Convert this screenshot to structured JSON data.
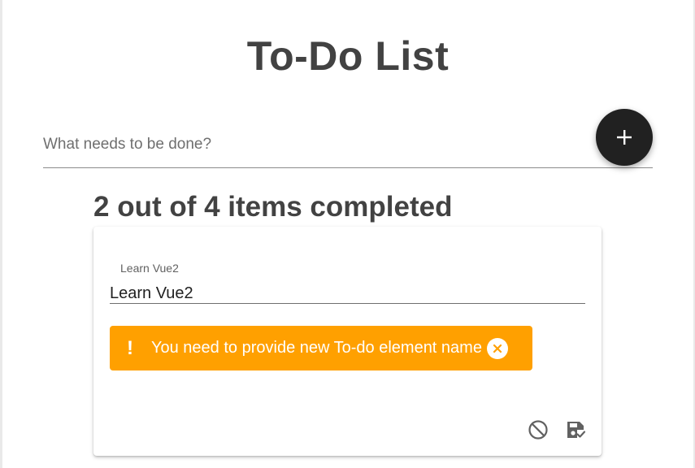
{
  "app": {
    "title": "To-Do List"
  },
  "new_todo": {
    "placeholder": "What needs to be done?",
    "value": "",
    "add_icon": "plus-icon"
  },
  "summary": {
    "text": "2 out of 4 items completed"
  },
  "edit_card": {
    "field_label": "Learn Vue2",
    "field_value": "Learn Vue2",
    "alert": {
      "text": "You need to provide new To-do element name",
      "icon": "exclamation-icon",
      "close_icon": "close-circle-icon",
      "color": "#ffa000"
    },
    "actions": [
      {
        "name": "cancel",
        "icon": "block-icon"
      },
      {
        "name": "save",
        "icon": "save-icon"
      }
    ]
  },
  "colors": {
    "fab": "#212121",
    "heading": "#424242",
    "alert": "#ffa000"
  }
}
